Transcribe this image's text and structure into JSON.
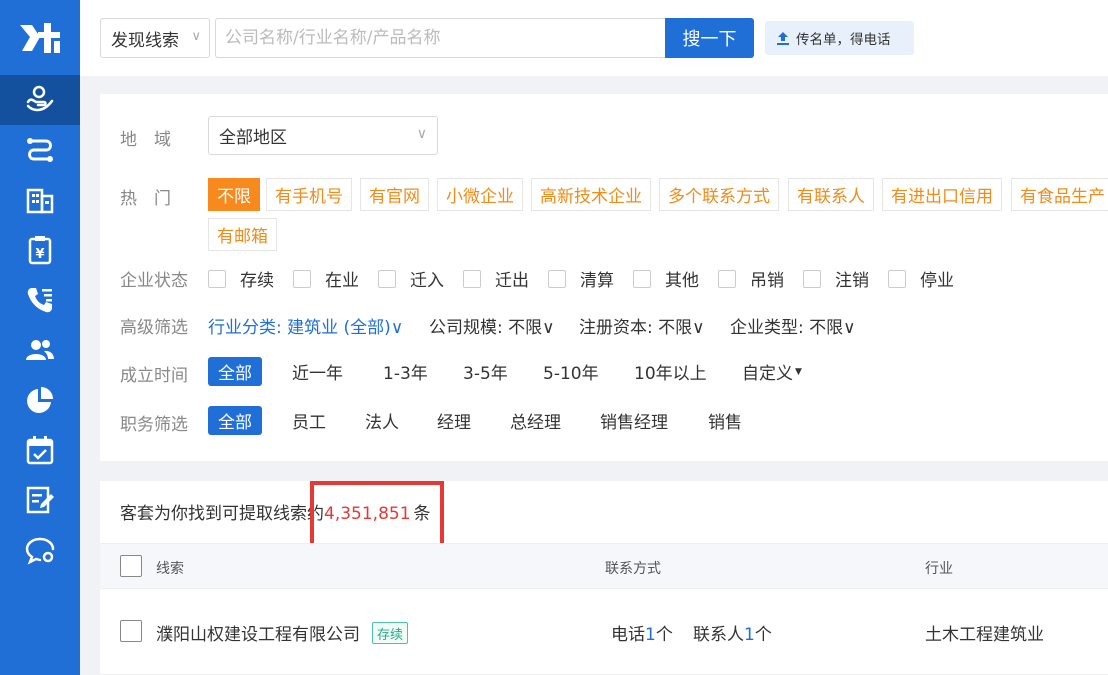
{
  "search": {
    "type_label": "发现线索",
    "placeholder": "公司名称/行业名称/产品名称",
    "button_label": "搜一下",
    "upload_label": "传名单，得电话"
  },
  "filters": {
    "region_label": "地　域",
    "region_value": "全部地区",
    "hot_label": "热　门",
    "hot_tags": [
      "不限",
      "有手机号",
      "有官网",
      "小微企业",
      "高新技术企业",
      "多个联系方式",
      "有联系人",
      "有进出口信用",
      "有食品生产",
      "有邮箱"
    ],
    "status_label": "企业状态",
    "statuses": [
      "存续",
      "在业",
      "迁入",
      "迁出",
      "清算",
      "其他",
      "吊销",
      "注销",
      "停业"
    ],
    "advanced_label": "高级筛选",
    "advanced": {
      "industry": "行业分类: 建筑业 (全部)",
      "scale": "公司规模: 不限",
      "capital": "注册资本: 不限",
      "type": "企业类型: 不限"
    },
    "founded_label": "成立时间",
    "founded_options": [
      "全部",
      "近一年",
      "1-3年",
      "3-5年",
      "5-10年",
      "10年以上",
      "自定义"
    ],
    "position_label": "职务筛选",
    "position_options": [
      "全部",
      "员工",
      "法人",
      "经理",
      "总经理",
      "销售经理",
      "销售"
    ]
  },
  "results": {
    "summary_prefix": "客套为你找到可提取线索约",
    "count": "4,351,851",
    "summary_suffix": "条",
    "columns": [
      "线索",
      "联系方式",
      "行业"
    ],
    "rows": [
      {
        "company": "濮阳山权建设工程有限公司",
        "status": "存续",
        "phone_label": "电话",
        "phone_count": "1",
        "contact_label": "联系人",
        "contact_count": "1",
        "unit": "个",
        "industry": "土木工程建筑业"
      }
    ]
  },
  "colors": {
    "primary": "#1f6fd6",
    "sidebar_active": "#13519f",
    "orange": "#f7891d",
    "red": "#e53935",
    "status_green": "#2aa88a"
  },
  "icons": [
    "logo-icon",
    "customer-icon",
    "route-icon",
    "building-icon",
    "receipt-icon",
    "phone-icon",
    "team-icon",
    "pie-chart-icon",
    "calendar-check-icon",
    "edit-icon",
    "chat-icon",
    "upload-icon",
    "chevron-down-icon"
  ]
}
